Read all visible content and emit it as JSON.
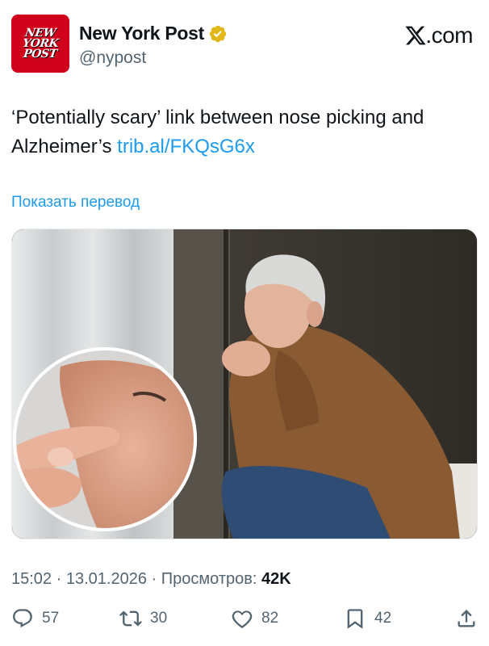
{
  "tweet": {
    "logo_lines": [
      "NEW",
      "YORK",
      "POST"
    ],
    "author_name": "New York Post",
    "handle": "@nypost",
    "brand_text": ".com",
    "text": "‘Potentially scary’ link between nose picking and Alzheimer’s",
    "link": "trib.al/FKQsG6x",
    "translate_label": "Показать перевод",
    "time": "15:02",
    "date": "13.01.2026",
    "views_label": "Просмотров:",
    "views_count": "42K"
  },
  "actions": {
    "reply_count": "57",
    "retweet_count": "30",
    "like_count": "82",
    "bookmark_count": "42"
  },
  "colors": {
    "accent": "#1d9bf0",
    "brand_red": "#d0021b",
    "verified_gold": "#e2b719",
    "muted": "#536471"
  }
}
